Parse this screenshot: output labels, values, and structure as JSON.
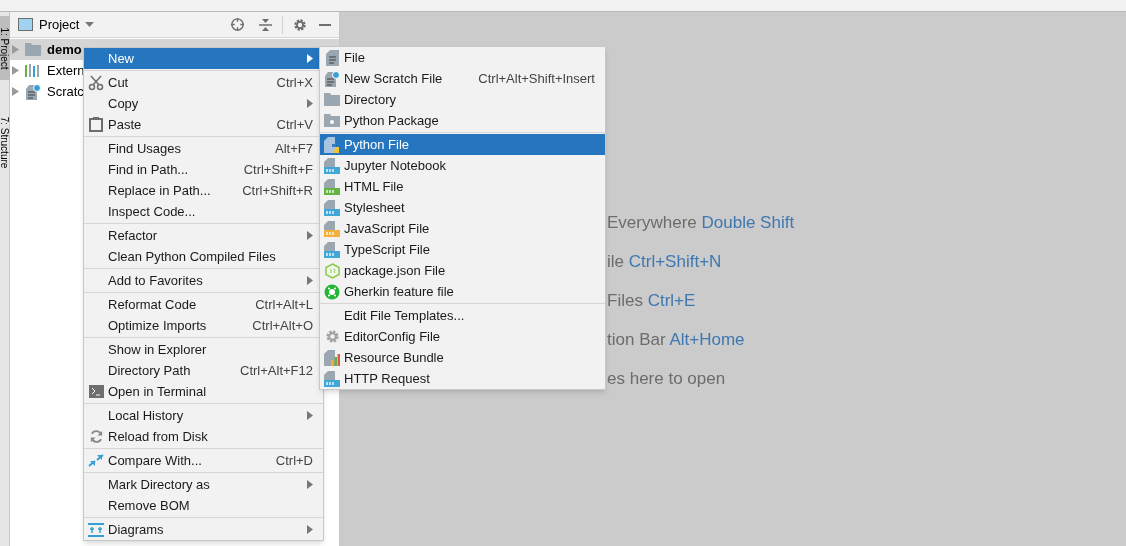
{
  "tool_strip": [
    {
      "label": "1: Project",
      "selected": true
    },
    {
      "label": "7: Structure",
      "selected": false
    }
  ],
  "project_panel": {
    "title": "Project",
    "tree": [
      {
        "label": "demo",
        "kind": "folder",
        "bold": true,
        "selected": true
      },
      {
        "label": "Extern",
        "kind": "library",
        "bold": false,
        "selected": false
      },
      {
        "label": "Scratc",
        "kind": "scratch",
        "bold": false,
        "selected": false
      }
    ]
  },
  "editor_hints": [
    {
      "text": "Everywhere",
      "shortcut": "Double Shift"
    },
    {
      "text": "ile",
      "shortcut": "Ctrl+Shift+N"
    },
    {
      "text": "Files",
      "shortcut": "Ctrl+E"
    },
    {
      "text": "tion Bar",
      "shortcut": "Alt+Home"
    },
    {
      "text": "es here to open"
    }
  ],
  "context_menu": {
    "groups": [
      [
        {
          "label": "New",
          "submenu": true,
          "selected": true
        }
      ],
      [
        {
          "label": "Cut",
          "shortcut": "Ctrl+X",
          "kind": "scissors",
          "selected": false
        },
        {
          "label": "Copy",
          "submenu": true,
          "selected": false
        },
        {
          "label": "Paste",
          "shortcut": "Ctrl+V",
          "kind": "clipboard",
          "selected": false
        }
      ],
      [
        {
          "label": "Find Usages",
          "shortcut": "Alt+F7",
          "selected": false
        },
        {
          "label": "Find in Path...",
          "shortcut": "Ctrl+Shift+F",
          "selected": false
        },
        {
          "label": "Replace in Path...",
          "shortcut": "Ctrl+Shift+R",
          "selected": false
        },
        {
          "label": "Inspect Code...",
          "selected": false
        }
      ],
      [
        {
          "label": "Refactor",
          "submenu": true,
          "selected": false
        },
        {
          "label": "Clean Python Compiled Files",
          "selected": false
        }
      ],
      [
        {
          "label": "Add to Favorites",
          "submenu": true,
          "selected": false
        }
      ],
      [
        {
          "label": "Reformat Code",
          "shortcut": "Ctrl+Alt+L",
          "selected": false
        },
        {
          "label": "Optimize Imports",
          "shortcut": "Ctrl+Alt+O",
          "selected": false
        }
      ],
      [
        {
          "label": "Show in Explorer",
          "selected": false
        },
        {
          "label": "Directory Path",
          "shortcut": "Ctrl+Alt+F12",
          "selected": false
        },
        {
          "label": "Open in Terminal",
          "kind": "terminal",
          "selected": false
        }
      ],
      [
        {
          "label": "Local History",
          "submenu": true,
          "selected": false
        },
        {
          "label": "Reload from Disk",
          "kind": "reload",
          "selected": false
        }
      ],
      [
        {
          "label": "Compare With...",
          "shortcut": "Ctrl+D",
          "kind": "compare",
          "selected": false
        }
      ],
      [
        {
          "label": "Mark Directory as",
          "submenu": true,
          "selected": false
        },
        {
          "label": "Remove BOM",
          "selected": false
        }
      ],
      [
        {
          "label": "Diagrams",
          "submenu": true,
          "kind": "diagram",
          "selected": false
        }
      ]
    ]
  },
  "new_submenu": {
    "groups": [
      [
        {
          "label": "File",
          "kind": "file",
          "selected": false
        },
        {
          "label": "New Scratch File",
          "shortcut": "Ctrl+Alt+Shift+Insert",
          "kind": "scratch",
          "selected": false
        },
        {
          "label": "Directory",
          "kind": "folder",
          "selected": false
        },
        {
          "label": "Python Package",
          "kind": "package",
          "selected": false
        }
      ],
      [
        {
          "label": "Python File",
          "kind": "python",
          "selected": true
        },
        {
          "label": "Jupyter Notebook",
          "kind": "badge",
          "color": "#40a8d8",
          "selected": false
        },
        {
          "label": "HTML File",
          "kind": "badge",
          "color": "#62b543",
          "selected": false
        },
        {
          "label": "Stylesheet",
          "kind": "badge",
          "color": "#40a8d8",
          "selected": false
        },
        {
          "label": "JavaScript File",
          "kind": "badge",
          "color": "#f4af3d",
          "selected": false
        },
        {
          "label": "TypeScript File",
          "kind": "badge",
          "color": "#40a8d8",
          "selected": false
        },
        {
          "label": "package.json File",
          "kind": "node",
          "selected": false
        },
        {
          "label": "Gherkin feature file",
          "kind": "gherkin",
          "selected": false
        }
      ],
      [
        {
          "label": "Edit File Templates...",
          "selected": false
        },
        {
          "label": "EditorConfig File",
          "kind": "gear",
          "selected": false
        },
        {
          "label": "Resource Bundle",
          "kind": "bars",
          "selected": false
        },
        {
          "label": "HTTP Request",
          "kind": "badge",
          "color": "#40a8d8",
          "selected": false
        }
      ]
    ]
  }
}
